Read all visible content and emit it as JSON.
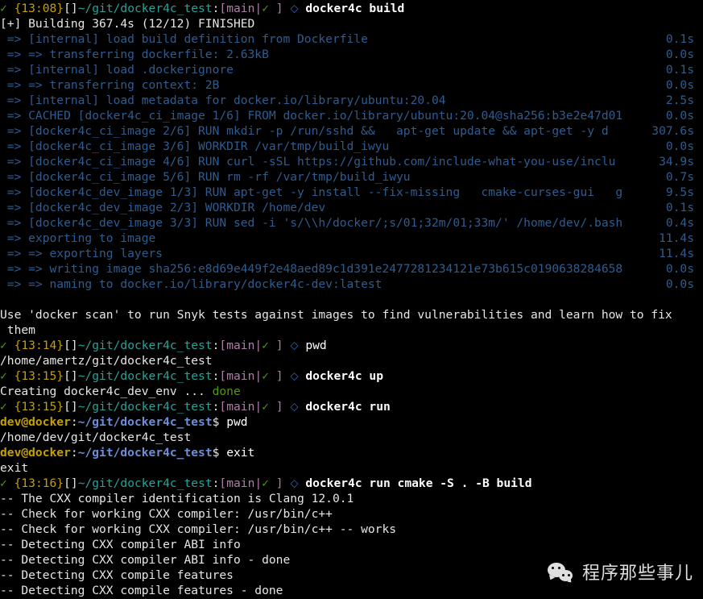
{
  "terminal": {
    "background": "#000000",
    "foreground": "#e6e6e6",
    "colors": {
      "ok_green": "#4e9a06",
      "prompt_time": "#c4a000",
      "prompt_path": "#2aa198",
      "git_branch": "#ad7fa8",
      "diamond": "#3465a4",
      "buildkit": "#2f5c8f",
      "container_user": "#c4a000",
      "container_path": "#6a8fd8"
    },
    "glyphs": {
      "check": "✓",
      "diamond": "⬦",
      "bracket_open": "[",
      "bracket_close": "]"
    }
  },
  "prompts": {
    "p1": {
      "time": "{13:08}",
      "jobs": "[]",
      "path": "~/git/docker4c_test",
      "colon": ":",
      "git": "[main|",
      "git_close": " ]",
      "command": "docker4c build"
    },
    "p2": {
      "time": "{13:14}",
      "jobs": "[]",
      "path": "~/git/docker4c_test",
      "colon": ":",
      "git": "[main|",
      "git_close": " ]",
      "command": "pwd"
    },
    "p3": {
      "time": "{13:15}",
      "jobs": "[]",
      "path": "~/git/docker4c_test",
      "colon": ":",
      "git": "[main|",
      "git_close": " ]",
      "command": "docker4c up"
    },
    "p4": {
      "time": "{13:15}",
      "jobs": "[]",
      "path": "~/git/docker4c_test",
      "colon": ":",
      "git": "[main|",
      "git_close": " ]",
      "command": "docker4c run"
    },
    "p5": {
      "time": "{13:16}",
      "jobs": "[]",
      "path": "~/git/docker4c_test",
      "colon": ":",
      "git": "[main|",
      "git_close": " ]",
      "command": "docker4c run cmake -S . -B build"
    }
  },
  "container_prompts": {
    "cp1": {
      "user": "dev@docker",
      "colon": ":",
      "path": "~/git/docker4c_test",
      "sigil": "$",
      "command": "pwd"
    },
    "cp2": {
      "user": "dev@docker",
      "colon": ":",
      "path": "~/git/docker4c_test",
      "sigil": "$",
      "command": "exit"
    }
  },
  "build": {
    "header": "[+] Building 367.4s (12/12) FINISHED",
    "steps": [
      {
        "text": " => [internal] load build definition from Dockerfile",
        "time": "0.1s"
      },
      {
        "text": " => => transferring dockerfile: 2.63kB",
        "time": "0.0s"
      },
      {
        "text": " => [internal] load .dockerignore",
        "time": "0.1s"
      },
      {
        "text": " => => transferring context: 2B",
        "time": "0.0s"
      },
      {
        "text": " => [internal] load metadata for docker.io/library/ubuntu:20.04",
        "time": "2.5s"
      },
      {
        "text": " => CACHED [docker4c_ci_image 1/6] FROM docker.io/library/ubuntu:20.04@sha256:b3e2e47d01",
        "time": "0.0s"
      },
      {
        "text": " => [docker4c_ci_image 2/6] RUN mkdir -p /run/sshd &&   apt-get update && apt-get -y d",
        "time": "307.6s"
      },
      {
        "text": " => [docker4c_ci_image 3/6] WORKDIR /var/tmp/build_iwyu",
        "time": "0.0s"
      },
      {
        "text": " => [docker4c_ci_image 4/6] RUN curl -sSL https://github.com/include-what-you-use/inclu",
        "time": "34.9s"
      },
      {
        "text": " => [docker4c_ci_image 5/6] RUN rm -rf /var/tmp/build_iwyu",
        "time": "0.7s"
      },
      {
        "text": " => [docker4c_dev_image 1/3] RUN apt-get -y install --fix-missing   cmake-curses-gui   g",
        "time": "9.5s"
      },
      {
        "text": " => [docker4c_dev_image 2/3] WORKDIR /home/dev",
        "time": "0.1s"
      },
      {
        "text": " => [docker4c_dev_image 3/3] RUN sed -i 's/\\\\h/docker/;s/01;32m/01;33m/' /home/dev/.bash",
        "time": "0.4s"
      },
      {
        "text": " => exporting to image",
        "time": "11.4s"
      },
      {
        "text": " => => exporting layers",
        "time": "11.4s"
      },
      {
        "text": " => => writing image sha256:e8d69e449f2e48aed89c1d391e2477281234121e73b615c0190638284658",
        "time": "0.0s"
      },
      {
        "text": " => => naming to docker.io/library/docker4c-dev:latest",
        "time": "0.0s"
      }
    ]
  },
  "messages": {
    "snyk_line1": "Use 'docker scan' to run Snyk tests against images to find vulnerabilities and learn how to fix",
    "snyk_line2": " them",
    "pwd_host": "/home/amertz/git/docker4c_test",
    "pwd_container": "/home/dev/git/docker4c_test",
    "creating_prefix": "Creating docker4c_dev_env ... ",
    "creating_status": "done",
    "exit_echo": "exit"
  },
  "cmake_output": [
    "-- The CXX compiler identification is Clang 12.0.1",
    "-- Check for working CXX compiler: /usr/bin/c++",
    "-- Check for working CXX compiler: /usr/bin/c++ -- works",
    "-- Detecting CXX compiler ABI info",
    "-- Detecting CXX compiler ABI info - done",
    "-- Detecting CXX compile features",
    "-- Detecting CXX compile features - done"
  ],
  "watermark": {
    "text": "程序那些事儿",
    "icon": "wechat-icon"
  }
}
